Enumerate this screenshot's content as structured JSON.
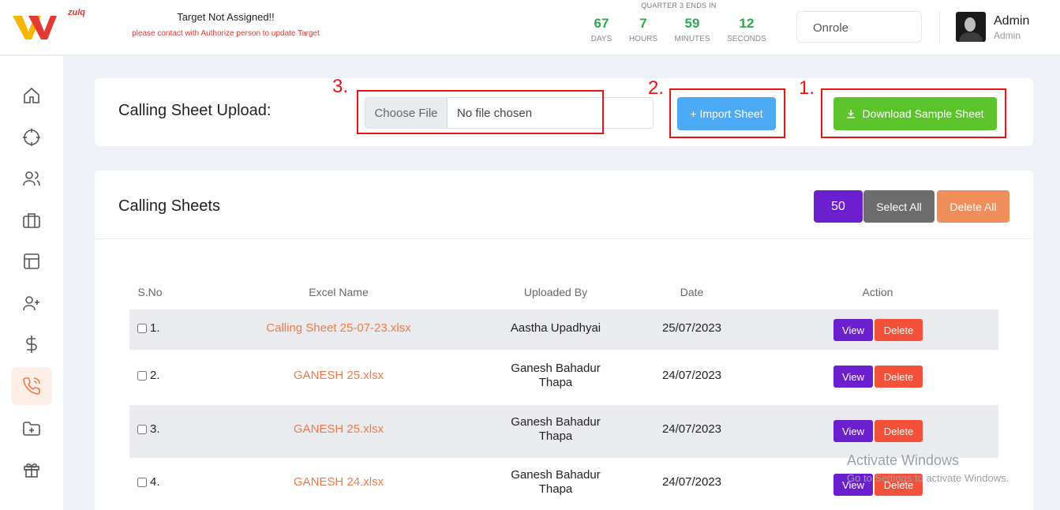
{
  "header": {
    "logo_small_text": "zulq",
    "target_title": "Target Not Assigned!!",
    "target_subtitle": "please contact with Authorize person to update Target",
    "countdown_label": "QUARTER 3 ENDS IN",
    "countdown": [
      {
        "value": "67",
        "unit": "DAYS"
      },
      {
        "value": "7",
        "unit": "HOURS"
      },
      {
        "value": "59",
        "unit": "MINUTES"
      },
      {
        "value": "12",
        "unit": "SECONDS"
      }
    ],
    "role_value": "Onrole",
    "user_name": "Admin",
    "user_role": "Admin"
  },
  "sidebar": {
    "items": [
      {
        "icon": "home-icon"
      },
      {
        "icon": "target-icon"
      },
      {
        "icon": "users-icon"
      },
      {
        "icon": "briefcase-icon"
      },
      {
        "icon": "layout-icon"
      },
      {
        "icon": "user-plus-icon"
      },
      {
        "icon": "dollar-icon"
      },
      {
        "icon": "phone-icon",
        "active": true
      },
      {
        "icon": "folder-plus-icon"
      },
      {
        "icon": "gift-icon"
      }
    ]
  },
  "upload": {
    "title": "Calling Sheet Upload:",
    "choose_file_label": "Choose File",
    "file_status": "No file chosen",
    "import_label": "+ Import Sheet",
    "download_label": "Download Sample Sheet",
    "annotations": [
      "1.",
      "2.",
      "3."
    ]
  },
  "sheets": {
    "title": "Calling Sheets",
    "page_size": "50",
    "select_all_label": "Select All",
    "delete_all_label": "Delete All",
    "columns": [
      "S.No",
      "Excel Name",
      "Uploaded By",
      "Date",
      "Action"
    ],
    "view_label": "View",
    "delete_label": "Delete",
    "rows": [
      {
        "sno": "1.",
        "excel": "Calling Sheet 25-07-23.xlsx",
        "by_line1": "Aastha Upadhyai",
        "by_line2": "",
        "date": "25/07/2023"
      },
      {
        "sno": "2.",
        "excel": "GANESH 25.xlsx",
        "by_line1": "Ganesh Bahadur",
        "by_line2": "Thapa",
        "date": "24/07/2023"
      },
      {
        "sno": "3.",
        "excel": "GANESH 25.xlsx",
        "by_line1": "Ganesh Bahadur",
        "by_line2": "Thapa",
        "date": "24/07/2023"
      },
      {
        "sno": "4.",
        "excel": "GANESH 24.xlsx",
        "by_line1": "Ganesh Bahadur",
        "by_line2": "Thapa",
        "date": "24/07/2023"
      }
    ]
  },
  "watermark": {
    "line1": "Activate Windows",
    "line2": "Go to Settings to activate Windows."
  },
  "colors": {
    "accent_purple": "#6b1fcf",
    "success_green": "#5ac42a",
    "import_blue": "#4daaf7",
    "link_orange": "#ef7a4b",
    "danger_red": "#f3513a",
    "annotation_red": "#e11111"
  }
}
